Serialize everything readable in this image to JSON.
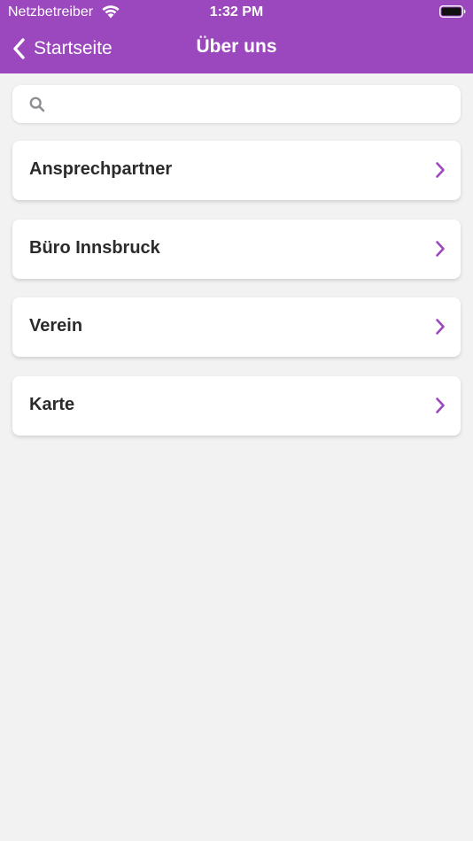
{
  "status_bar": {
    "carrier": "Netzbetreiber",
    "time": "1:32 PM",
    "wifi_icon": "wifi-icon",
    "battery_icon": "battery-full-icon"
  },
  "nav": {
    "back_label": "Startseite",
    "back_icon": "chevron-left-icon",
    "title": "Über uns"
  },
  "search": {
    "icon": "search-icon",
    "placeholder": "",
    "value": ""
  },
  "menu": {
    "items": [
      {
        "label": "Ansprechpartner",
        "icon": "chevron-right-icon"
      },
      {
        "label": "Büro Innsbruck",
        "icon": "chevron-right-icon"
      },
      {
        "label": "Verein",
        "icon": "chevron-right-icon"
      },
      {
        "label": "Karte",
        "icon": "chevron-right-icon"
      }
    ]
  },
  "colors": {
    "brand": "#9b47bd",
    "background": "#f2f2f2",
    "card": "#ffffff",
    "accent": "#9b47bd",
    "text": "#2b2b2b"
  }
}
